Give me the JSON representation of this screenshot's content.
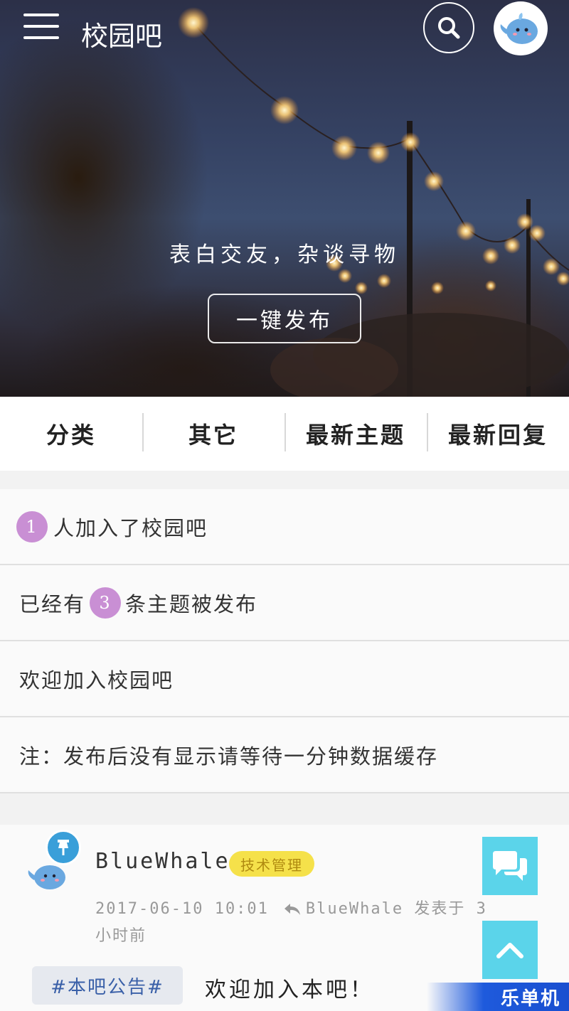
{
  "header": {
    "title": "校园吧",
    "menu_icon": "menu-icon",
    "search_icon": "search-icon",
    "avatar": "whale-avatar"
  },
  "hero": {
    "tagline": "表白交友，杂谈寻物",
    "publish_label": "一键发布"
  },
  "nav": {
    "items": [
      {
        "label": "分类"
      },
      {
        "label": "其它"
      },
      {
        "label": "最新主题"
      },
      {
        "label": "最新回复"
      }
    ]
  },
  "info": {
    "joined_count": "1",
    "joined_text": "人加入了校园吧",
    "topics_prefix": "已经有",
    "topics_count": "3",
    "topics_suffix": "条主题被发布",
    "welcome": "欢迎加入校园吧",
    "note": "注：发布后没有显示请等待一分钟数据缓存"
  },
  "post": {
    "author": "BlueWhale",
    "role": "技术管理",
    "date": "2017-06-10 10:01",
    "reply_author": "BlueWhale",
    "reply_text": "发表于 3小时前",
    "tag": "#本吧公告#",
    "title": "欢迎加入本吧！",
    "pin_icon": "pin-icon"
  },
  "floating": {
    "chat_icon": "chat-icon",
    "top_icon": "chevron-up-icon"
  },
  "watermark": "乐单机",
  "colors": {
    "badge": "#c98fd4",
    "role_badge": "#f5e14a",
    "float_button": "#5bd4ea",
    "pin": "#3a9fd9",
    "tag_text": "#3a60a8"
  }
}
